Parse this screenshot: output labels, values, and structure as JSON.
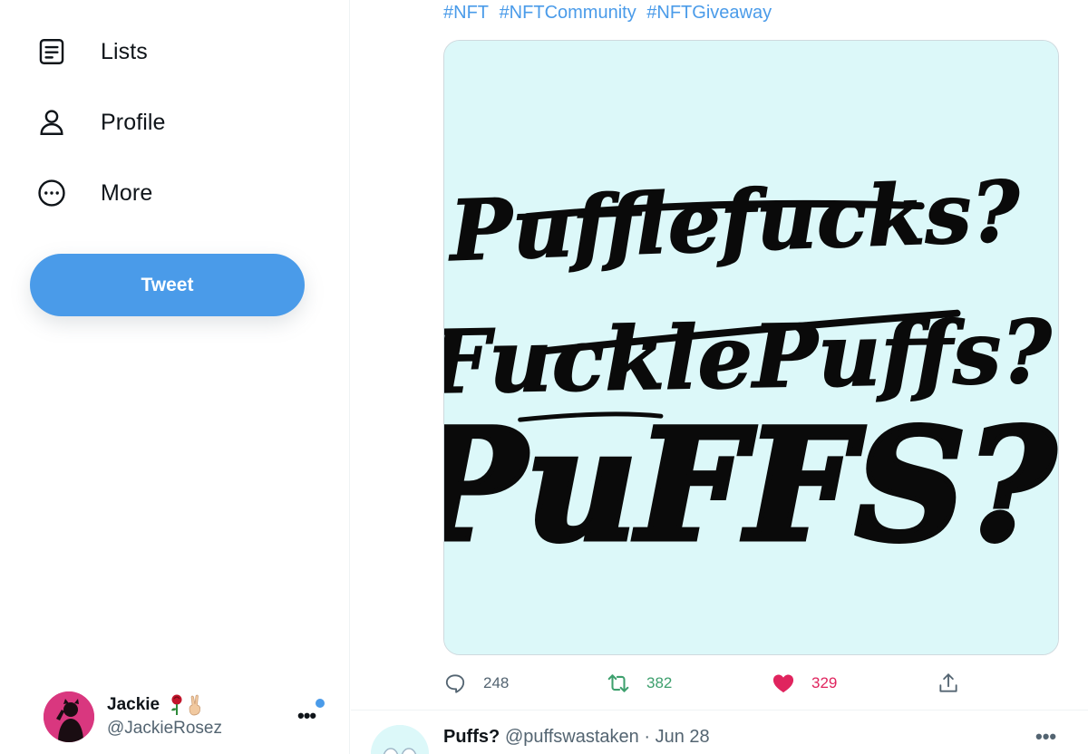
{
  "sidebar": {
    "items": [
      {
        "label": "Lists",
        "icon": "lists-icon"
      },
      {
        "label": "Profile",
        "icon": "profile-icon"
      },
      {
        "label": "More",
        "icon": "more-circle-icon"
      }
    ],
    "tweet_button": "Tweet",
    "account": {
      "name": "Jackie",
      "name_emoji": [
        "rose-emoji",
        "victory-hand-emoji"
      ],
      "handle": "@JackieRosez",
      "more": "•••",
      "notification_color": "#4a9be9"
    }
  },
  "tweet": {
    "hashtags": [
      "#NFT",
      "#NFTCommunity",
      "#NFTGiveaway"
    ],
    "image": {
      "background": "#dcf8f9",
      "lines": [
        "Pufflefucks?",
        "FucklePuffs?",
        "PuFFS?"
      ],
      "crossed_out": [
        true,
        true,
        false
      ]
    },
    "actions": {
      "reply_count": "248",
      "retweet_count": "382",
      "like_count": "329",
      "liked": true
    }
  },
  "next_tweet": {
    "name": "Puffs?",
    "handle": "@puffswastaken",
    "separator": "·",
    "date": "Jun 28",
    "more": "•••"
  },
  "colors": {
    "accent": "#4a9be9",
    "retweet": "#3ea06e",
    "like": "#e0245e",
    "muted": "#536471"
  }
}
